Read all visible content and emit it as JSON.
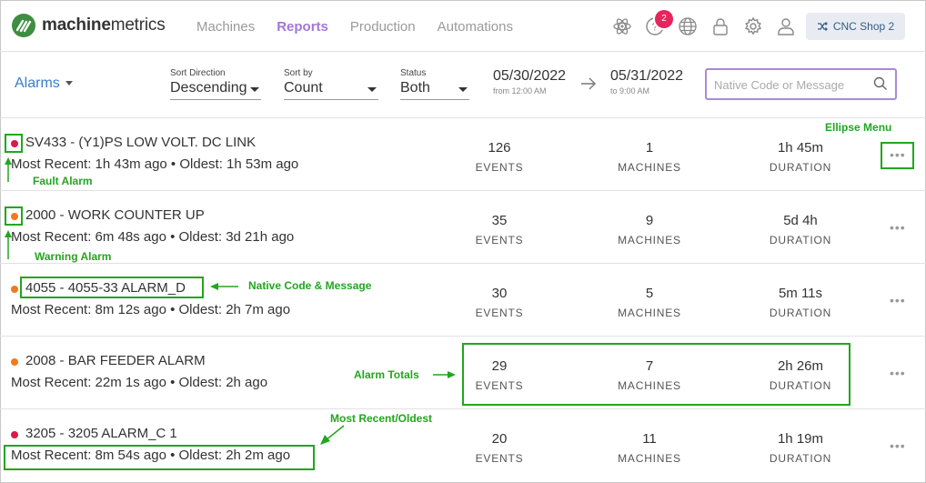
{
  "header": {
    "logo_bold": "machine",
    "logo_light": "metrics",
    "nav": [
      "Machines",
      "Reports",
      "Production",
      "Automations"
    ],
    "active_nav": "Reports",
    "notification_count": "2",
    "shop_button": "CNC Shop 2",
    "icons": [
      "atom-icon",
      "help-icon",
      "globe-icon",
      "lock-icon",
      "gear-icon",
      "user-icon"
    ]
  },
  "toolbar": {
    "view_dropdown": "Alarms",
    "sort_direction_label": "Sort Direction",
    "sort_direction_value": "Descending",
    "sort_by_label": "Sort by",
    "sort_by_value": "Count",
    "status_label": "Status",
    "status_value": "Both",
    "date_from": "05/30/2022",
    "date_from_sub": "from 12:00 AM",
    "date_to": "05/31/2022",
    "date_to_sub": "to 9:00 AM",
    "search_placeholder": "Native Code or Message"
  },
  "stat_labels": {
    "events": "EVENTS",
    "machines": "MACHINES",
    "duration": "DURATION"
  },
  "alarms": [
    {
      "type": "fault",
      "title": "SV433 - (Y1)PS LOW VOLT. DC LINK",
      "recent": "Most Recent: 1h 43m ago • Oldest: 1h 53m ago",
      "events": "126",
      "machines": "1",
      "duration": "1h 45m"
    },
    {
      "type": "warning",
      "title": "2000 - WORK COUNTER UP",
      "recent": "Most Recent: 6m 48s ago • Oldest: 3d 21h ago",
      "events": "35",
      "machines": "9",
      "duration": "5d 4h"
    },
    {
      "type": "warning",
      "title": "4055 - 4055-33 ALARM_D",
      "recent": "Most Recent: 8m 12s ago • Oldest: 2h 7m ago",
      "events": "30",
      "machines": "5",
      "duration": "5m 11s"
    },
    {
      "type": "warning",
      "title": "2008 - BAR FEEDER ALARM",
      "recent": "Most Recent: 22m 1s ago • Oldest: 2h ago",
      "events": "29",
      "machines": "7",
      "duration": "2h 26m"
    },
    {
      "type": "fault",
      "title": "3205 - 3205 ALARM_C 1",
      "recent": "Most Recent: 8m 54s ago • Oldest: 2h 2m ago",
      "events": "20",
      "machines": "11",
      "duration": "1h 19m"
    }
  ],
  "annotations": {
    "ellipse_menu": "Ellipse Menu",
    "fault_alarm": "Fault Alarm",
    "warning_alarm": "Warning Alarm",
    "native_code": "Native Code & Message",
    "alarm_totals": "Alarm Totals",
    "most_recent": "Most Recent/Oldest"
  },
  "colors": {
    "accent": "#a178d6",
    "link": "#3a7bc8",
    "fault": "#d81b47",
    "warning": "#f07a1e",
    "annotation": "#22a61f",
    "badge": "#e6245e"
  }
}
